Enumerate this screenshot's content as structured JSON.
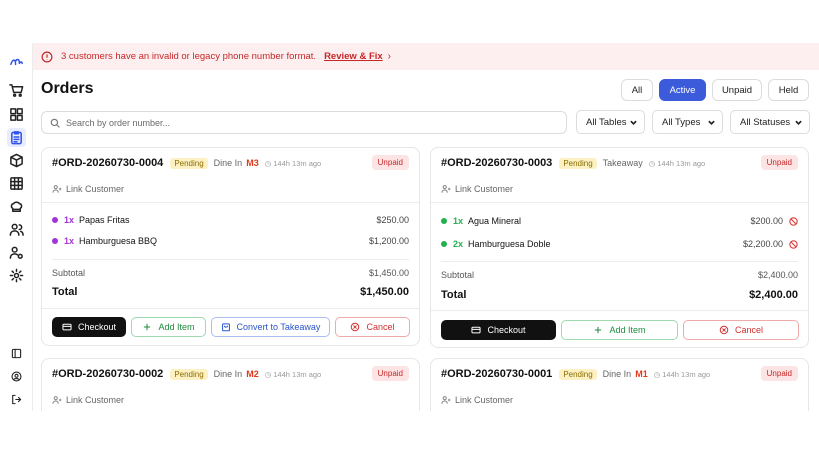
{
  "banner": {
    "message": "3 customers have an invalid or legacy phone number format.",
    "link": "Review & Fix",
    "chevron": "›",
    "icon": "alert-circle-icon"
  },
  "page": {
    "title": "Orders"
  },
  "filters": {
    "tabs": [
      "All",
      "Active",
      "Unpaid",
      "Held"
    ],
    "active_tab": "Active",
    "search_placeholder": "Search by order number...",
    "selects": [
      "All Tables",
      "All Types",
      "All Statuses"
    ]
  },
  "sidebar": {
    "icons": [
      "logo-icon",
      "cart-icon",
      "grid-icon",
      "clipboard-icon",
      "box-icon",
      "table-icon",
      "chef-hat-icon",
      "users-icon",
      "user-settings-icon",
      "settings-icon",
      "panel-icon",
      "user-circle-icon",
      "logout-icon"
    ],
    "active": "clipboard-icon"
  },
  "colors": {
    "accent": "#3b5bdb",
    "danger": "#c62828",
    "success": "#1e8a3c"
  },
  "common": {
    "link_customer": "Link Customer",
    "subtotal_label": "Subtotal",
    "total_label": "Total",
    "checkout": "Checkout",
    "add_item": "Add Item",
    "convert": "Convert to Takeaway",
    "cancel": "Cancel"
  },
  "orders": [
    {
      "number": "#ORD-20260730-0004",
      "status": "Pending",
      "type": "Dine In",
      "table": "M3",
      "time": "144h 13m ago",
      "payment": "Unpaid",
      "items": [
        {
          "qty": "1x",
          "name": "Papas Fritas",
          "price": "$250.00",
          "dot": "#a233d6"
        },
        {
          "qty": "1x",
          "name": "Hamburguesa BBQ",
          "price": "$1,200.00",
          "dot": "#a233d6"
        }
      ],
      "subtotal": "$1,450.00",
      "total": "$1,450.00"
    },
    {
      "number": "#ORD-20260730-0003",
      "status": "Pending",
      "type": "Takeaway",
      "table": "",
      "time": "144h 13m ago",
      "payment": "Unpaid",
      "items": [
        {
          "qty": "1x",
          "name": "Agua Mineral",
          "price": "$200.00",
          "dot": "#22b14c"
        },
        {
          "qty": "2x",
          "name": "Hamburguesa Doble",
          "price": "$2,200.00",
          "dot": "#22b14c"
        }
      ],
      "subtotal": "$2,400.00",
      "total": "$2,400.00"
    },
    {
      "number": "#ORD-20260730-0002",
      "status": "Pending",
      "type": "Dine In",
      "table": "M2",
      "time": "144h 13m ago",
      "payment": "Unpaid"
    },
    {
      "number": "#ORD-20260730-0001",
      "status": "Pending",
      "type": "Dine In",
      "table": "M1",
      "time": "144h 13m ago",
      "payment": "Unpaid"
    }
  ]
}
